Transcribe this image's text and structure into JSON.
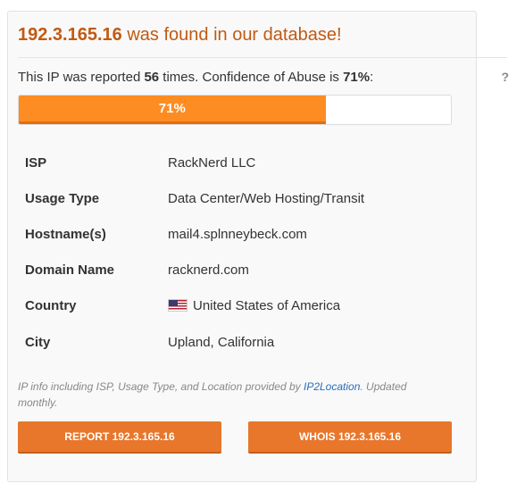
{
  "header": {
    "ip": "192.3.165.16",
    "found_text": " was found in our database!"
  },
  "summary": {
    "prefix": "This IP was reported ",
    "count": "56",
    "middle": " times. Confidence of Abuse is ",
    "confidence": "71%",
    "suffix": ":",
    "help": "?"
  },
  "confidence_bar": {
    "percent": 71,
    "label": "71%",
    "fill_color": "#fd8c22"
  },
  "details": [
    {
      "label": "ISP",
      "value": "RackNerd LLC"
    },
    {
      "label": "Usage Type",
      "value": "Data Center/Web Hosting/Transit"
    },
    {
      "label": "Hostname(s)",
      "value": "mail4.splnneybeck.com"
    },
    {
      "label": "Domain Name",
      "value": "racknerd.com"
    },
    {
      "label": "Country",
      "value": "United States of America",
      "icon": "us-flag-icon"
    },
    {
      "label": "City",
      "value": "Upland, California"
    }
  ],
  "footer_note": {
    "text": "IP info including ISP, Usage Type, and Location provided by ",
    "link": "IP2Location",
    "after": ". Updated monthly."
  },
  "buttons": {
    "report": "REPORT 192.3.165.16",
    "whois": "WHOIS 192.3.165.16"
  },
  "colors": {
    "title": "#c15a12",
    "button": "#e8762b",
    "link": "#2a6ebb"
  }
}
